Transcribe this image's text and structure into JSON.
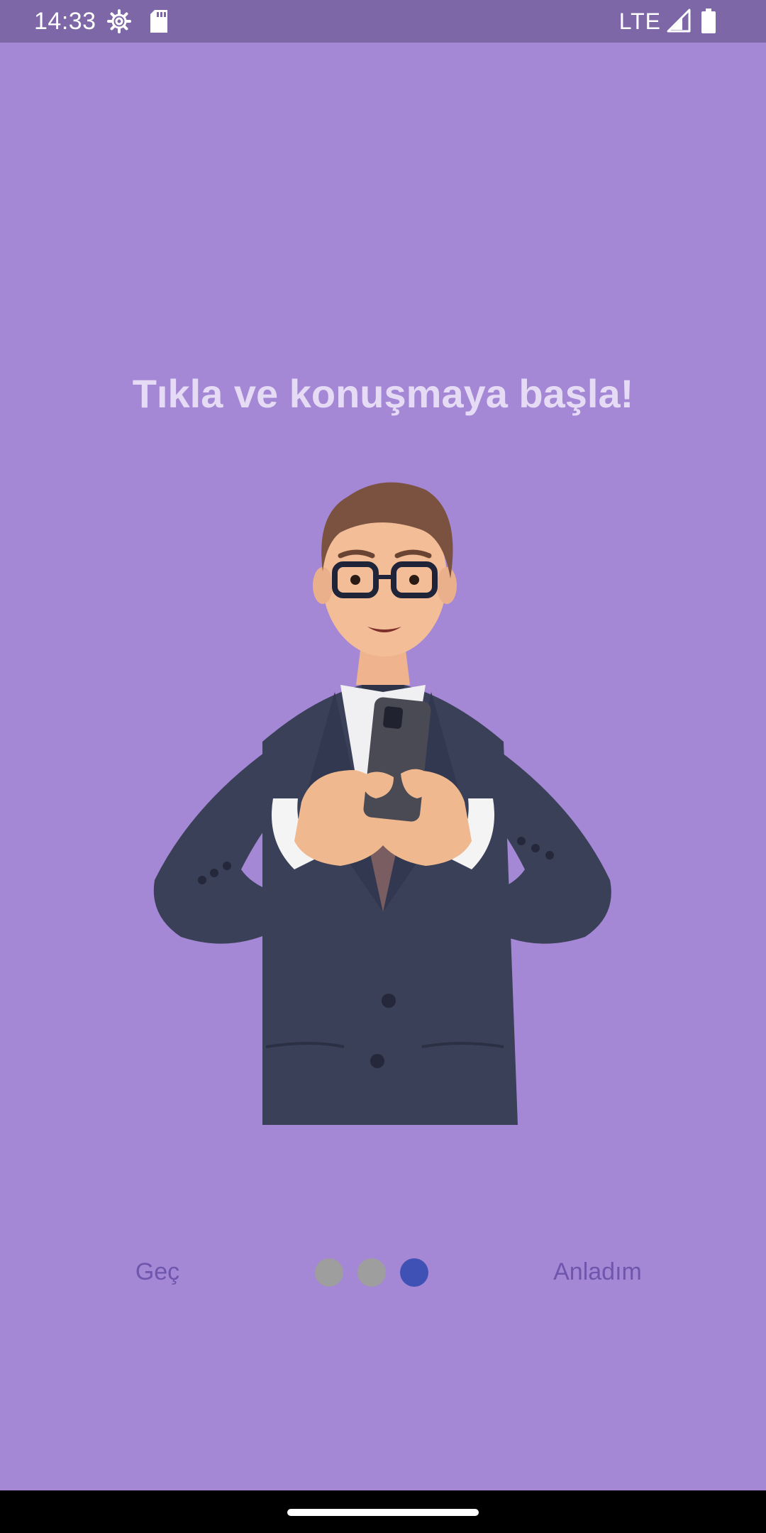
{
  "status_bar": {
    "time": "14:33",
    "network": "LTE",
    "icons": [
      "settings-gear-icon",
      "sd-card-icon",
      "signal-icon",
      "battery-icon"
    ]
  },
  "onboarding": {
    "title": "Tıkla ve konuşmaya başla!",
    "illustration": "businessman-with-phone",
    "skip_label": "Geç",
    "confirm_label": "Anladım",
    "page_indicator": {
      "total": 3,
      "current": 3
    }
  },
  "colors": {
    "background": "#a588d5",
    "status_bar": "#7d67a6",
    "title_text": "#e6dbf5",
    "action_text": "#6f56ad",
    "dot_inactive": "#9e9e9e",
    "dot_active": "#3f51b5"
  }
}
